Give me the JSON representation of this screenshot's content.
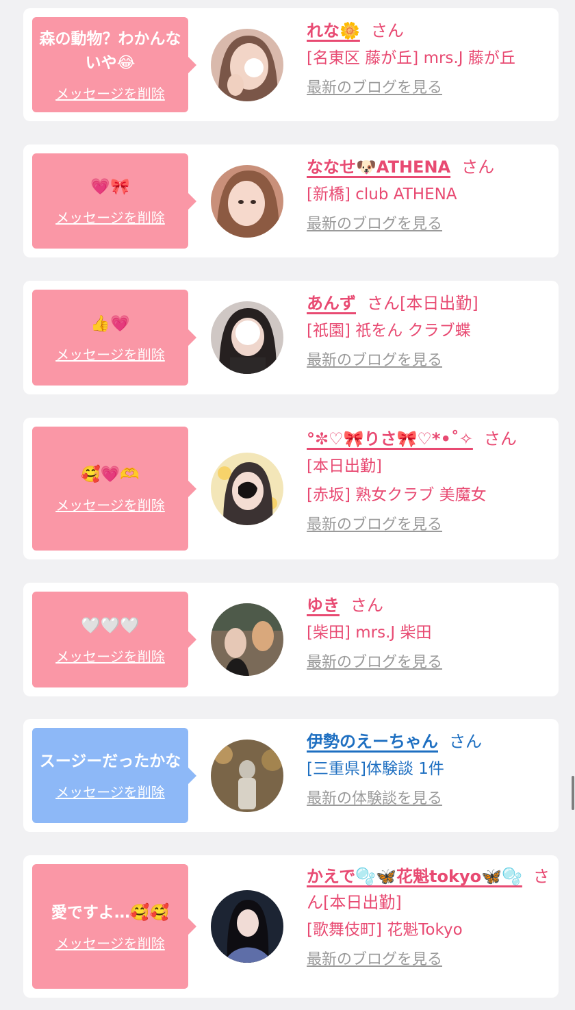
{
  "messages": [
    {
      "message": "森の動物？わかんないや😂",
      "delete_label": "メッセージを削除",
      "name": "れな🌼",
      "suffix": "さん",
      "status": "",
      "lines": [
        "[名東区 藤が丘] mrs.J 藤が丘"
      ],
      "link": "最新のブログを見る",
      "theme": "pink"
    },
    {
      "message": "💗🎀",
      "delete_label": "メッセージを削除",
      "name": "ななせ🐶ATHENA",
      "suffix": "さん",
      "status": "",
      "lines": [
        "[新橋] club ATHENA"
      ],
      "link": "最新のブログを見る",
      "theme": "pink"
    },
    {
      "message": "👍💗",
      "delete_label": "メッセージを削除",
      "name": "あんず",
      "suffix": "さん",
      "status": "[本日出勤]",
      "lines": [
        "[祇園] 祇をん クラブ蝶"
      ],
      "link": "最新のブログを見る",
      "theme": "pink"
    },
    {
      "message": "🥰💗🫶",
      "delete_label": "メッセージを削除",
      "name": "°✼♡🎀りさ🎀♡*•˚✧",
      "suffix": "さん",
      "status": "",
      "lines": [
        "[本日出勤]",
        "[赤坂] 熟女クラブ 美魔女"
      ],
      "link": "最新のブログを見る",
      "theme": "pink"
    },
    {
      "message": "🤍🤍🤍",
      "delete_label": "メッセージを削除",
      "name": "ゆき",
      "suffix": "さん",
      "status": "",
      "lines": [
        "[柴田] mrs.J 柴田"
      ],
      "link": "最新のブログを見る",
      "theme": "pink"
    },
    {
      "message": "スージーだったかな",
      "delete_label": "メッセージを削除",
      "name": "伊勢のえーちゃん",
      "suffix": "さん",
      "status": "",
      "lines": [
        "[三重県]体験談 1件"
      ],
      "link": "最新の体験談を見る",
      "theme": "blue"
    },
    {
      "message": "愛ですよ…🥰🥰",
      "delete_label": "メッセージを削除",
      "name": "かえで🫧🦋花魁tokyo🦋🫧",
      "suffix": "さん",
      "status": "[本日出勤]",
      "lines": [
        "[歌舞伎町] 花魁Tokyo"
      ],
      "link": "最新のブログを見る",
      "theme": "pink"
    }
  ],
  "colors": {
    "page_bg": "#f1f1f3",
    "card_bg": "#ffffff",
    "pink_bubble": "#fa97a6",
    "blue_bubble": "#8db8f7",
    "name_pink": "#e84a72",
    "name_blue": "#1e6fc1",
    "link_gray": "#9a9a9a"
  },
  "icons": [
    "avatar-photo"
  ]
}
